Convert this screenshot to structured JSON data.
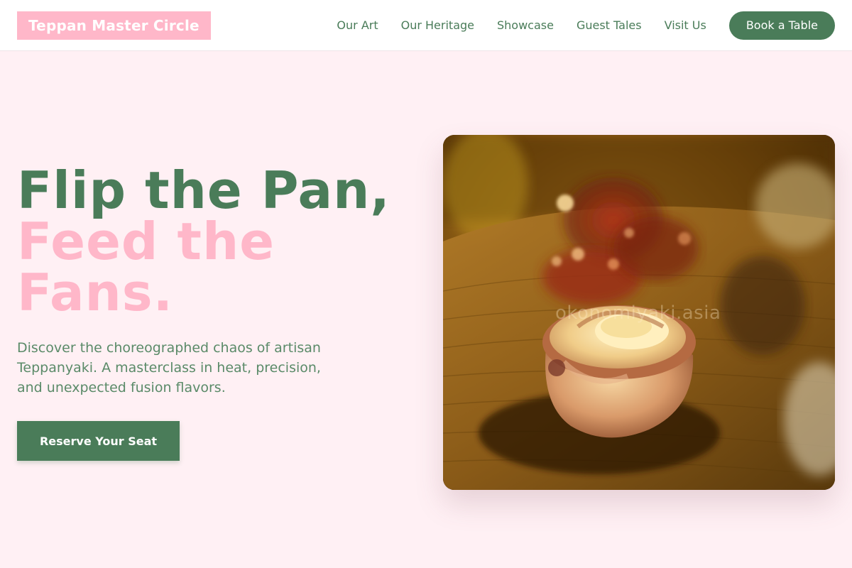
{
  "header": {
    "logo": "Teppan Master Circle",
    "nav": [
      {
        "label": "Our Art"
      },
      {
        "label": "Our Heritage"
      },
      {
        "label": "Showcase"
      },
      {
        "label": "Guest Tales"
      },
      {
        "label": "Visit Us"
      }
    ],
    "book_label": "Book a Table"
  },
  "hero": {
    "title_line1": "Flip the Pan,",
    "title_line2": "Feed the",
    "title_line3": "Fans.",
    "description": "Discover the choreographed chaos of artisan Teppanyaki. A masterclass in heat, precision, and unexpected fusion flavors.",
    "cta_label": "Reserve Your Seat",
    "image": {
      "subject": "sushi-roll-photo",
      "watermark": "okonomiyaki.asia"
    }
  },
  "colors": {
    "primary_green": "#4a7c59",
    "accent_pink": "#ffb7c9",
    "page_background": "#fff0f4"
  }
}
